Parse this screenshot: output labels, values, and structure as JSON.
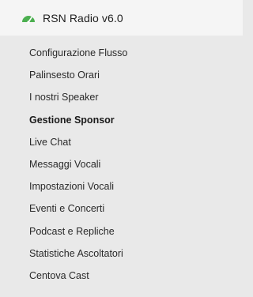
{
  "header": {
    "title": "RSN Radio v6.0",
    "icon": "gauge-icon",
    "icon_color": "#4caf50"
  },
  "menu": {
    "active_index": 3,
    "items": [
      {
        "label": "Configurazione Flusso"
      },
      {
        "label": "Palinsesto Orari"
      },
      {
        "label": "I nostri Speaker"
      },
      {
        "label": "Gestione Sponsor"
      },
      {
        "label": "Live Chat"
      },
      {
        "label": "Messaggi Vocali"
      },
      {
        "label": "Impostazioni Vocali"
      },
      {
        "label": "Eventi e Concerti"
      },
      {
        "label": "Podcast e Repliche"
      },
      {
        "label": "Statistiche Ascoltatori"
      },
      {
        "label": "Centova Cast"
      }
    ]
  }
}
